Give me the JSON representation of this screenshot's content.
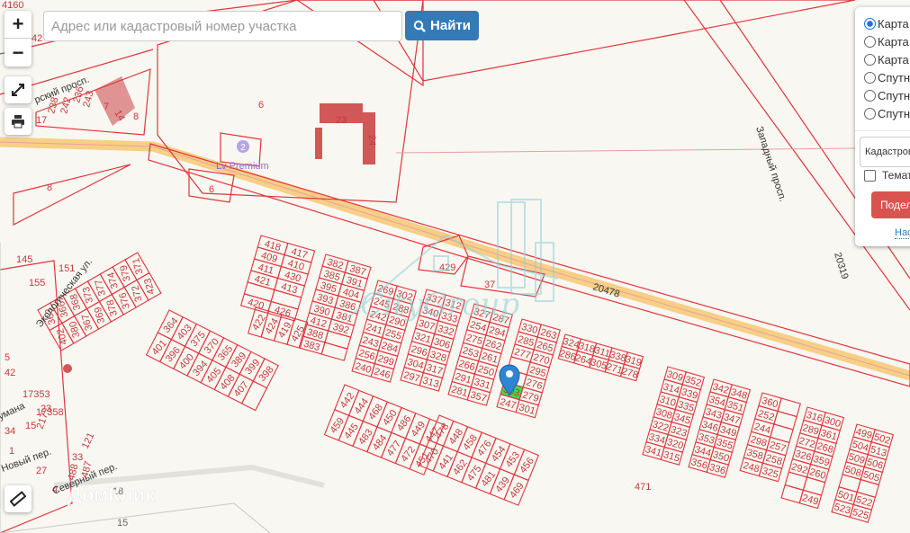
{
  "search": {
    "placeholder": "Адрес или кадастровый номер участка",
    "button_label": "Найти"
  },
  "controls": {
    "zoom_in": "+",
    "zoom_out": "−"
  },
  "layers": {
    "options": [
      {
        "label": "Карта",
        "selected": true
      },
      {
        "label": "Карта",
        "selected": false
      },
      {
        "label": "Карта",
        "selected": false
      },
      {
        "label": "Спутн",
        "selected": false
      },
      {
        "label": "Спутн",
        "selected": false
      },
      {
        "label": "Спутн",
        "selected": false
      }
    ],
    "select_value": "Кадастров",
    "checkbox_label": "Темат",
    "share_button": "Подел",
    "link": "Нас"
  },
  "colors": {
    "accent": "#337ab7",
    "parcel": "#e0353c",
    "road": "#f7cf85",
    "selected_parcel": "#3fd94f",
    "share": "#d9534f",
    "marker": "#2f86d0"
  },
  "map": {
    "streets": [
      "рский просп.",
      "Западный просп.",
      "20478",
      "20319",
      "Экологическая ул.",
      "Новый пер.",
      "Северный пер.",
      "умана"
    ],
    "poi": {
      "badge": "2",
      "label": "Lv Premium"
    },
    "watermarks": {
      "center": "CityGroup",
      "bottom": "ДомКлик"
    },
    "misc_labels": [
      "4160",
      "42",
      "6",
      "23",
      "24",
      "17",
      "238",
      "242",
      "236",
      "243",
      "7",
      "14",
      "8",
      "6",
      "8",
      "145",
      "155",
      "151",
      "429",
      "37",
      "5",
      "42",
      "17353",
      "23",
      "17358",
      "15",
      "34",
      "217",
      "33",
      "27",
      "121",
      "487",
      "488",
      "4",
      "18",
      "15",
      "1",
      "471"
    ],
    "selected_parcel": "303",
    "blocks": [
      [
        [
          "418",
          "417"
        ],
        [
          "409",
          "410"
        ],
        [
          "411",
          "430"
        ],
        [
          "421",
          "413"
        ],
        [
          "",
          ""
        ],
        [
          "420",
          "426"
        ]
      ],
      [
        [
          "422",
          "424",
          "419",
          "425"
        ]
      ],
      [
        [
          "382",
          "387"
        ],
        [
          "385",
          "391"
        ],
        [
          "395",
          "404"
        ],
        [
          "393",
          "386"
        ],
        [
          "390",
          "381"
        ],
        [
          "412",
          "392"
        ],
        [
          "388",
          ""
        ],
        [
          "383",
          ""
        ]
      ],
      [
        [
          "364",
          "403",
          "375",
          "370",
          "365",
          "389",
          "399",
          "398"
        ],
        [
          "401",
          "396",
          "400",
          "394",
          "405",
          "408",
          "407",
          ""
        ]
      ],
      [
        [
          "363",
          "366",
          "368",
          "373",
          "377",
          "374",
          "379",
          "371"
        ],
        [
          "402",
          "380",
          "367",
          "369",
          "378",
          "376",
          "372",
          "423"
        ]
      ],
      [
        [
          "269",
          "302"
        ],
        [
          "245",
          "288"
        ],
        [
          "242",
          "290"
        ],
        [
          "241",
          "255"
        ],
        [
          "243",
          "284"
        ],
        [
          "256",
          "299"
        ],
        [
          "240",
          "246"
        ]
      ],
      [
        [
          "337",
          "312"
        ],
        [
          "340",
          "333"
        ],
        [
          "307",
          "332"
        ],
        [
          "321",
          "306"
        ],
        [
          "296",
          "328"
        ],
        [
          "304",
          "317"
        ],
        [
          "297",
          "313"
        ]
      ],
      [
        [
          "327",
          "287"
        ],
        [
          "254",
          "294"
        ],
        [
          "275",
          "262"
        ],
        [
          "253",
          "261"
        ],
        [
          "266",
          "250"
        ],
        [
          "291",
          "331"
        ],
        [
          "281",
          "357"
        ]
      ],
      [
        [
          "330",
          "263"
        ],
        [
          "285",
          "265"
        ],
        [
          "277",
          "270"
        ],
        [
          "",
          "295"
        ],
        [
          "",
          "276"
        ],
        [
          "303",
          "279"
        ],
        [
          "247",
          "301"
        ]
      ],
      [
        [
          "324",
          "318",
          "311",
          "338",
          "319"
        ],
        [
          "286",
          "264",
          "305",
          "271",
          "278"
        ]
      ],
      [
        [
          "309",
          "352"
        ],
        [
          "314",
          "339"
        ],
        [
          "310",
          "335"
        ],
        [
          "308",
          "345"
        ],
        [
          "322",
          "323"
        ],
        [
          "334",
          "320"
        ],
        [
          "341",
          "315"
        ]
      ],
      [
        [
          "342",
          "348"
        ],
        [
          "354",
          "351"
        ],
        [
          "343",
          "347"
        ],
        [
          "346",
          "349"
        ],
        [
          "353",
          "355"
        ],
        [
          "344",
          "350"
        ],
        [
          "356",
          "336"
        ]
      ],
      [
        [
          "360",
          ""
        ],
        [
          "252",
          ""
        ],
        [
          "244",
          ""
        ],
        [
          "298",
          "257"
        ],
        [
          "358",
          "258"
        ],
        [
          "248",
          "325"
        ]
      ],
      [
        [
          "316",
          "300"
        ],
        [
          "289",
          "361"
        ],
        [
          "272",
          "268"
        ],
        [
          "326",
          "359"
        ],
        [
          "292",
          "260"
        ],
        [
          "",
          ""
        ],
        [
          "",
          "249"
        ]
      ],
      [
        [
          "499",
          "502"
        ],
        [
          "504",
          "513"
        ],
        [
          "509",
          "506"
        ],
        [
          "508",
          "505"
        ],
        [
          "",
          ""
        ],
        [
          "501",
          "522"
        ],
        [
          "523",
          "525"
        ]
      ],
      [
        [
          "442",
          "444",
          "468",
          "450",
          "486",
          "449",
          "447"
        ],
        [
          "459",
          "445",
          "483",
          "484",
          "477",
          "472",
          "451"
        ]
      ],
      [
        [
          "478",
          "448",
          "458",
          "476",
          "454",
          "453",
          "456"
        ],
        [
          "470",
          "441",
          "462",
          "475",
          "481",
          "439",
          "469"
        ]
      ]
    ]
  }
}
